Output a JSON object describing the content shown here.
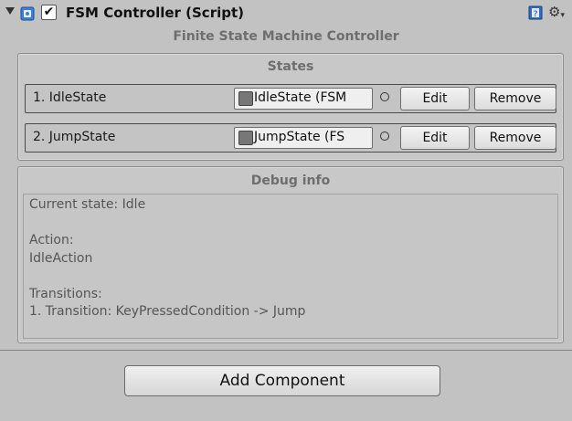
{
  "header": {
    "title": "FSM Controller (Script)",
    "enabled": true,
    "check_glyph": "✔"
  },
  "subtitle": "Finite State Machine Controller",
  "states": {
    "title": "States",
    "items": [
      {
        "label": "1. IdleState",
        "object": "IdleState (FSM",
        "edit": "Edit",
        "remove": "Remove"
      },
      {
        "label": "2. JumpState",
        "object": "JumpState (FS",
        "edit": "Edit",
        "remove": "Remove"
      }
    ]
  },
  "debug": {
    "title": "Debug info",
    "lines": [
      "Current state: Idle",
      "",
      "Action:",
      "IdleAction",
      "",
      "Transitions:",
      "1. Transition: KeyPressedCondition -> Jump"
    ]
  },
  "add_component": "Add Component",
  "icons": {
    "foldout": "foldout-triangle-icon",
    "script": "script-icon",
    "help": "help-book-icon",
    "gear": "gear-icon",
    "object": "object-icon",
    "picker": "object-picker-icon"
  }
}
